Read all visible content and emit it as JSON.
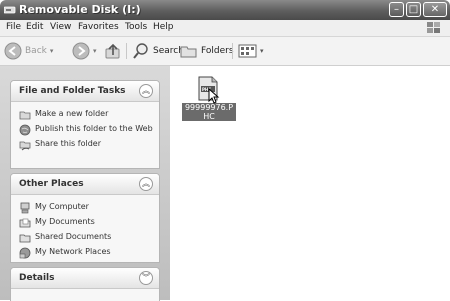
{
  "window": {
    "title": "Removable Disk (I:)"
  },
  "menu": [
    "File",
    "Edit",
    "View",
    "Favorites",
    "Tools",
    "Help"
  ],
  "toolbar": {
    "back": "Back",
    "search": "Search",
    "folders": "Folders"
  },
  "panels": {
    "file_tasks": {
      "title": "File and Folder Tasks",
      "items": [
        "Make a new folder",
        "Publish this folder to the Web",
        "Share this folder"
      ]
    },
    "other_places": {
      "title": "Other Places",
      "items": [
        "My Computer",
        "My Documents",
        "Shared Documents",
        "My Network Places"
      ]
    },
    "details": {
      "title": "Details"
    }
  },
  "files": [
    {
      "name": "99999976.PHC",
      "type_badge": "PHC"
    }
  ]
}
